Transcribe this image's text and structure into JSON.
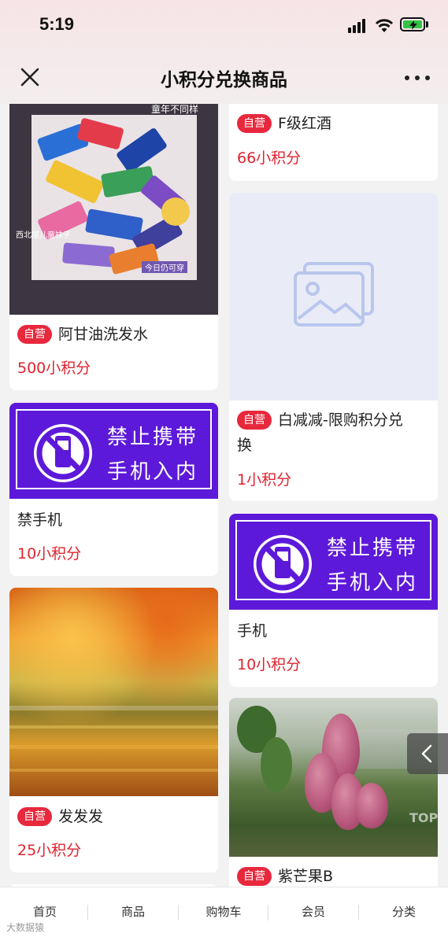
{
  "status": {
    "time": "5:19"
  },
  "nav": {
    "title": "小积分兑换商品"
  },
  "products": {
    "socks": {
      "image_caption": "童年不同样",
      "image_caption2": "西北屋儿童袜子",
      "image_caption3": "今日仍可穿",
      "tag": "自营",
      "title": "阿甘油洗发水",
      "price": "500小积分"
    },
    "wine": {
      "tag": "自营",
      "title": "F级红酒",
      "price": "66小积分"
    },
    "whitereduce": {
      "tag": "自营",
      "title_line1": "白减减-限购积分兑",
      "title_line2": "换",
      "price": "1小积分"
    },
    "nophone1": {
      "sign_line1": "禁止携带",
      "sign_line2": "手机入内",
      "title": "禁手机",
      "price": "10小积分"
    },
    "nophone2": {
      "sign_line1": "禁止携带",
      "sign_line2": "手机入内",
      "title": "手机",
      "price": "10小积分"
    },
    "autumn": {
      "tag": "自营",
      "title": "发发发",
      "price": "25小积分"
    },
    "mango": {
      "tag": "自营",
      "title": "紫芒果B"
    }
  },
  "side": {
    "top_label": "TOP"
  },
  "tabbar": {
    "items": [
      "首页",
      "商品",
      "购物车",
      "会员",
      "分类"
    ]
  },
  "watermark": "大数据猿"
}
